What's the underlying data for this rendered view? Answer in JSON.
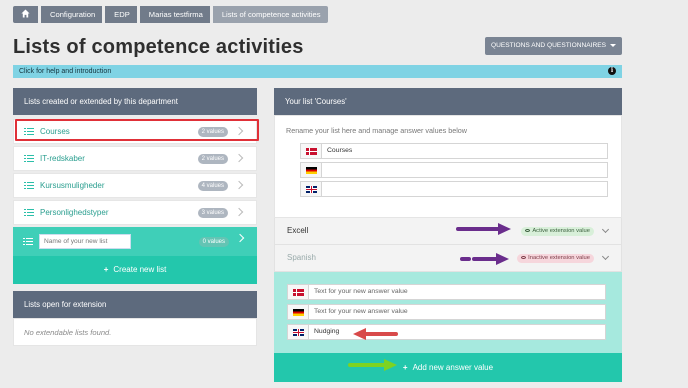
{
  "breadcrumb": {
    "items": [
      "Configuration",
      "EDP",
      "Marias testfirma",
      "Lists of competence activities"
    ]
  },
  "page_title": "Lists of competence activities",
  "questions_button": "QUESTIONS AND QUESTIONNAIRES",
  "help_bar": "Click for help and introduction",
  "left_panel": {
    "header": "Lists created or extended by this department",
    "lists": [
      {
        "label": "Courses",
        "badge": "2 values"
      },
      {
        "label": "IT-redskaber",
        "badge": "2 values"
      },
      {
        "label": "Kursusmuligheder",
        "badge": "4 values"
      },
      {
        "label": "Personlighedstyper",
        "badge": "3 values"
      }
    ],
    "new_list_placeholder": "Name of your new list",
    "new_list_badge": "0 values",
    "create_button": "Create new list"
  },
  "extension_panel": {
    "header": "Lists open for extension",
    "empty_text": "No extendable lists found."
  },
  "right_panel": {
    "header": "Your list 'Courses'",
    "hint": "Rename your list here and manage answer values below",
    "name_da": "Courses",
    "name_de": "",
    "name_en": "",
    "values": [
      {
        "label": "Excell",
        "status": "Active extension value",
        "state": "active"
      },
      {
        "label": "Spanish",
        "status": "Inactive extension value",
        "state": "inactive"
      }
    ],
    "new_value_placeholder": "Text for your new answer value",
    "new_value_en": "Nudging",
    "add_button": "Add new answer value"
  },
  "colors": {
    "accent": "#23c7ac",
    "panel_header": "#5d6a7d",
    "highlight_box": "#e03038",
    "arrow_purple": "#6a2d8c",
    "arrow_red": "#d84a4a",
    "arrow_green": "#7ed321"
  },
  "icons": [
    "home-icon",
    "info-icon",
    "list-icon",
    "chevron-right-icon",
    "chevron-down-icon",
    "eye-icon",
    "plus-icon",
    "flag-dk-icon",
    "flag-de-icon",
    "flag-gb-icon"
  ]
}
